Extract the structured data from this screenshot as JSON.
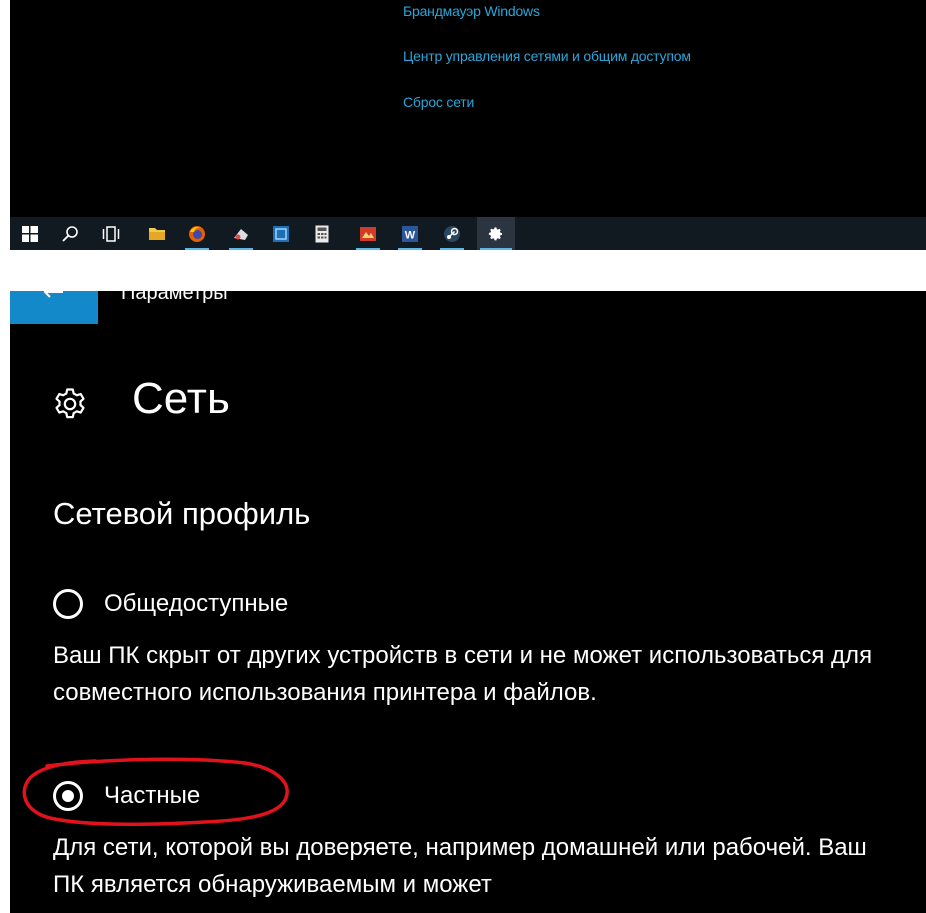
{
  "top_window": {
    "related_links": [
      {
        "label": "Брандмауэр Windows"
      },
      {
        "label": "Центр управления сетями и общим доступом"
      },
      {
        "label": "Сброс сети"
      }
    ]
  },
  "taskbar": {
    "items": [
      {
        "icon": "windows-start-icon",
        "open": false
      },
      {
        "icon": "search-icon",
        "open": false
      },
      {
        "icon": "task-view-icon",
        "open": false
      },
      {
        "icon": "file-explorer-icon",
        "open": false
      },
      {
        "icon": "firefox-icon",
        "open": true
      },
      {
        "icon": "app-icon",
        "open": true
      },
      {
        "icon": "app-icon",
        "open": false
      },
      {
        "icon": "calculator-icon",
        "open": false
      },
      {
        "icon": "app-icon",
        "open": true
      },
      {
        "icon": "word-icon",
        "open": true
      },
      {
        "icon": "steam-icon",
        "open": true
      },
      {
        "icon": "settings-gear-icon",
        "open": true,
        "active": true
      }
    ]
  },
  "settings": {
    "window_title": "Параметры",
    "page_title": "Сеть",
    "section_title": "Сетевой профиль",
    "profiles": [
      {
        "label": "Общедоступные",
        "checked": false,
        "description": "Ваш ПК скрыт от других устройств в сети и не может использоваться для совместного использования принтера и файлов."
      },
      {
        "label": "Частные",
        "checked": true,
        "description": "Для сети, которой вы доверяете, например домашней или рабочей. Ваш ПК является обнаруживаемым и может"
      }
    ]
  },
  "colors": {
    "accent": "#1389c9",
    "link": "#2aa6d9",
    "annotation": "#e0121b",
    "background": "#000000",
    "taskbar": "#121a21"
  }
}
